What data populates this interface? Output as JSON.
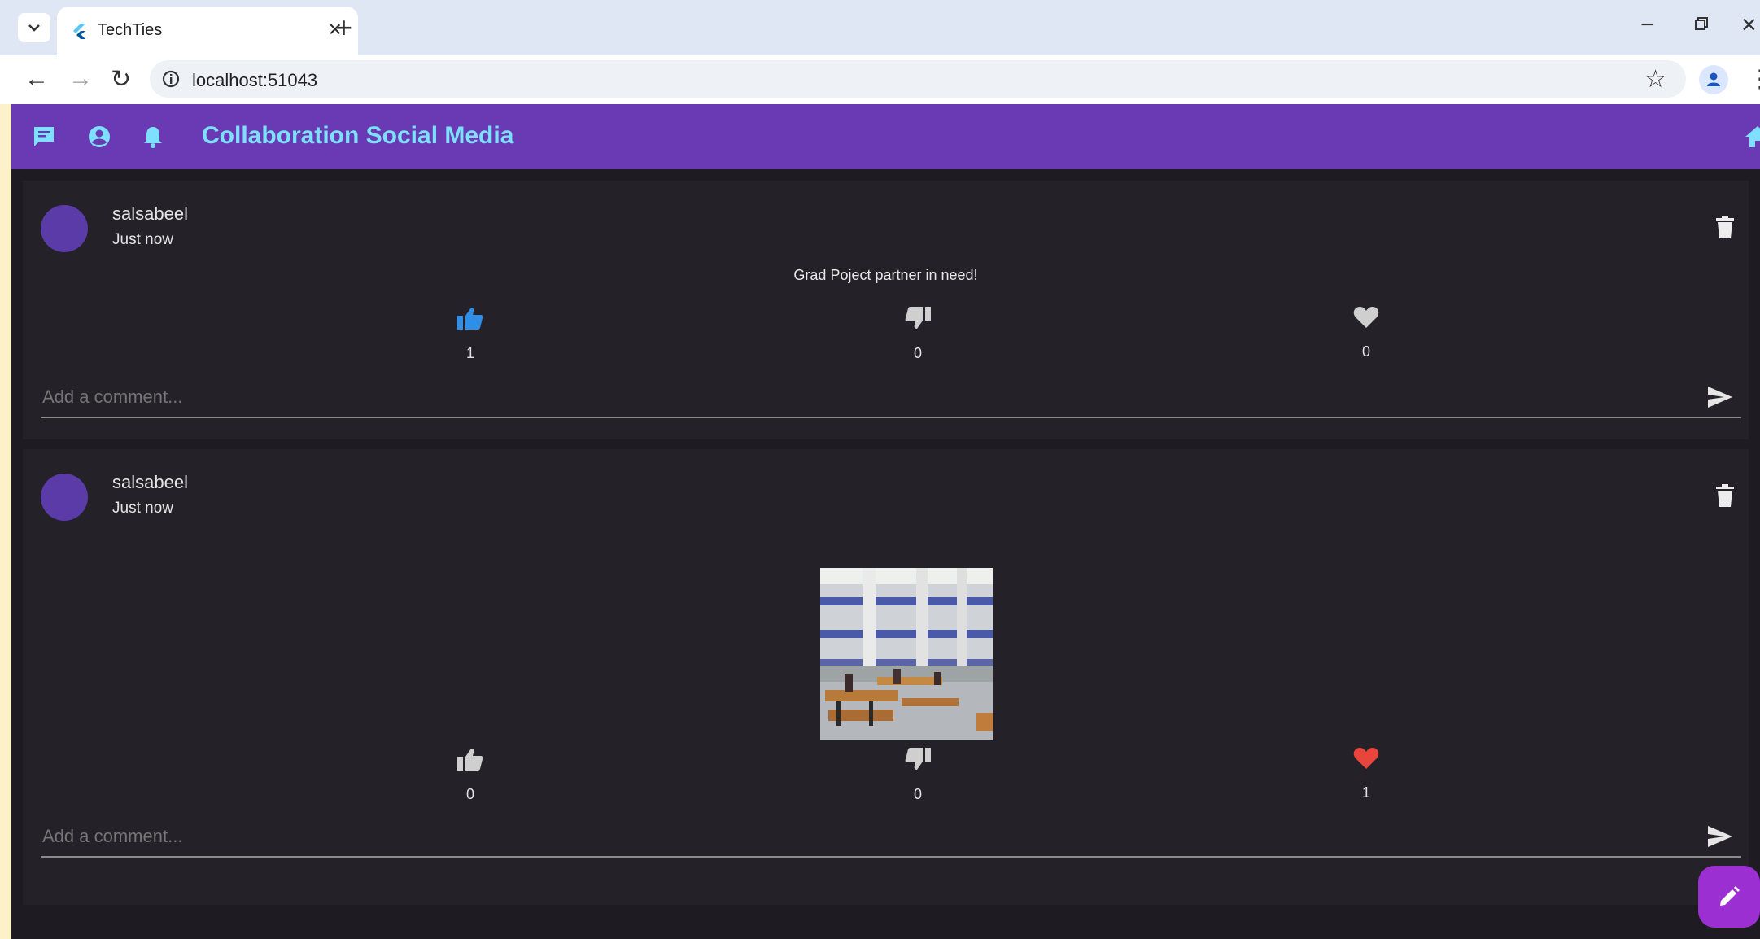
{
  "browser": {
    "tab_title": "TechTies",
    "url": "localhost:51043"
  },
  "appbar": {
    "title": "Collaboration Social Media",
    "icons": [
      "chat-icon",
      "account-circle-icon",
      "notifications-icon",
      "home-icon"
    ]
  },
  "posts": [
    {
      "author": "salsabeel",
      "time": "Just now",
      "text": "Grad Poject partner in need!",
      "has_image": false,
      "likes": "1",
      "dislikes": "0",
      "hearts": "0",
      "like_active": true,
      "heart_active": false,
      "comment_placeholder": "Add a comment..."
    },
    {
      "author": "salsabeel",
      "time": "Just now",
      "text": "",
      "has_image": true,
      "likes": "0",
      "dislikes": "0",
      "hearts": "1",
      "like_active": false,
      "heart_active": true,
      "comment_placeholder": "Add a comment..."
    }
  ],
  "colors": {
    "appbar": "#6a3ab4",
    "title": "#7ee0ff",
    "background": "#1e1c22",
    "card": "#242228",
    "like_active": "#2f8fe6",
    "heart_active": "#e8453c",
    "fab": "#9c2fd1"
  }
}
